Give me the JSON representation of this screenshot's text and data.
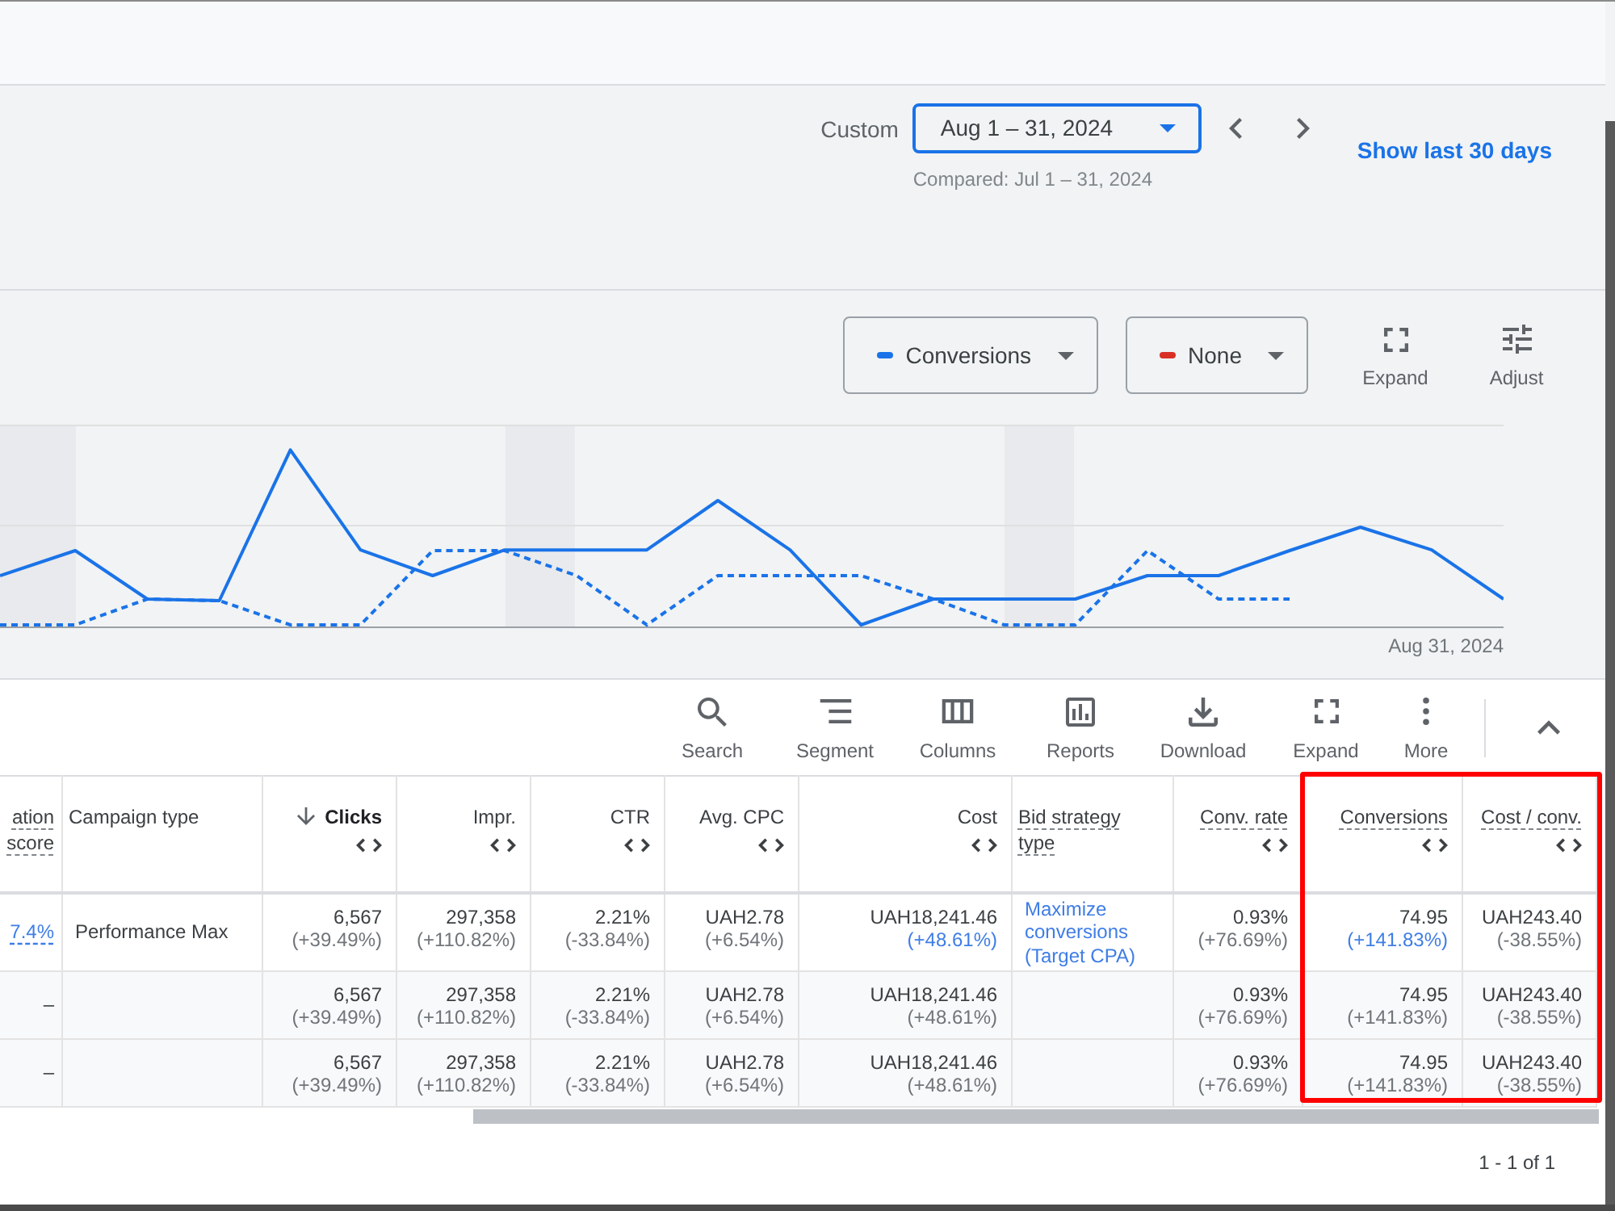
{
  "date_range": {
    "label": "Custom",
    "value": "Aug 1 – 31, 2024",
    "compared": "Compared: Jul 1 – 31, 2024",
    "shortcut": "Show last 30 days"
  },
  "chart": {
    "metrics": [
      {
        "label": "Conversions",
        "color": "#1a73e8"
      },
      {
        "label": "None",
        "color": "#d93025"
      }
    ],
    "actions": [
      {
        "kind": "expand",
        "label": "Expand"
      },
      {
        "kind": "adjust",
        "label": "Adjust"
      }
    ],
    "end_date": "Aug 31, 2024"
  },
  "toolbar": {
    "actions": [
      {
        "kind": "search",
        "label": "Search"
      },
      {
        "kind": "segment",
        "label": "Segment"
      },
      {
        "kind": "columns",
        "label": "Columns"
      },
      {
        "kind": "reports",
        "label": "Reports"
      },
      {
        "kind": "download",
        "label": "Download"
      },
      {
        "kind": "expand",
        "label": "Expand"
      },
      {
        "kind": "more",
        "label": "More"
      }
    ]
  },
  "table": {
    "columns": [
      {
        "label": "ation score",
        "kind": "score",
        "underlined": true,
        "sorted": false,
        "highlighted": false
      },
      {
        "label": "Campaign type",
        "kind": "text",
        "underlined": false,
        "sorted": false,
        "highlighted": false
      },
      {
        "label": "Clicks",
        "kind": "metric",
        "underlined": false,
        "sorted": true,
        "highlighted": false
      },
      {
        "label": "Impr.",
        "kind": "metric",
        "underlined": false,
        "sorted": false,
        "highlighted": false
      },
      {
        "label": "CTR",
        "kind": "metric",
        "underlined": false,
        "sorted": false,
        "highlighted": false
      },
      {
        "label": "Avg. CPC",
        "kind": "metric",
        "underlined": false,
        "sorted": false,
        "highlighted": false
      },
      {
        "label": "Cost",
        "kind": "metric",
        "underlined": false,
        "sorted": false,
        "highlighted": false
      },
      {
        "label": "Bid strategy type",
        "kind": "text",
        "underlined": true,
        "sorted": false,
        "highlighted": false
      },
      {
        "label": "Conv. rate",
        "kind": "metric",
        "underlined": true,
        "sorted": false,
        "highlighted": false
      },
      {
        "label": "Conversions",
        "kind": "metric",
        "underlined": true,
        "sorted": false,
        "highlighted": true
      },
      {
        "label": "Cost / conv.",
        "kind": "metric",
        "underlined": true,
        "sorted": false,
        "highlighted": true
      }
    ],
    "rows": [
      {
        "kind": "campaign",
        "cells": [
          {
            "text": "7.4%",
            "linked": true
          },
          {
            "text": "Performance Max",
            "linked": false
          },
          {
            "value": "6,567",
            "change": "(+39.49%)",
            "linked": false
          },
          {
            "value": "297,358",
            "change": "(+110.82%)",
            "linked": false
          },
          {
            "value": "2.21%",
            "change": "(-33.84%)",
            "linked": false
          },
          {
            "value": "UAH2.78",
            "change": "(+6.54%)",
            "linked": false
          },
          {
            "value": "UAH18,241.46",
            "change": "(+48.61%)",
            "linked": true
          },
          {
            "text": "Maximize conversions (Target CPA)",
            "linked": true
          },
          {
            "value": "0.93%",
            "change": "(+76.69%)",
            "linked": false
          },
          {
            "value": "74.95",
            "change": "(+141.83%)",
            "linked": true
          },
          {
            "value": "UAH243.40",
            "change": "(-38.55%)",
            "linked": false
          }
        ]
      },
      {
        "kind": "total",
        "cells": [
          {
            "text": "–",
            "linked": false
          },
          null,
          {
            "value": "6,567",
            "change": "(+39.49%)",
            "linked": false
          },
          {
            "value": "297,358",
            "change": "(+110.82%)",
            "linked": false
          },
          {
            "value": "2.21%",
            "change": "(-33.84%)",
            "linked": false
          },
          {
            "value": "UAH2.78",
            "change": "(+6.54%)",
            "linked": false
          },
          {
            "value": "UAH18,241.46",
            "change": "(+48.61%)",
            "linked": false
          },
          null,
          {
            "value": "0.93%",
            "change": "(+76.69%)",
            "linked": false
          },
          {
            "value": "74.95",
            "change": "(+141.83%)",
            "linked": false
          },
          {
            "value": "UAH243.40",
            "change": "(-38.55%)",
            "linked": false
          }
        ]
      },
      {
        "kind": "total",
        "cells": [
          {
            "text": "–",
            "linked": false
          },
          null,
          {
            "value": "6,567",
            "change": "(+39.49%)",
            "linked": false
          },
          {
            "value": "297,358",
            "change": "(+110.82%)",
            "linked": false
          },
          {
            "value": "2.21%",
            "change": "(-33.84%)",
            "linked": false
          },
          {
            "value": "UAH2.78",
            "change": "(+6.54%)",
            "linked": false
          },
          {
            "value": "UAH18,241.46",
            "change": "(+48.61%)",
            "linked": false
          },
          null,
          {
            "value": "0.93%",
            "change": "(+76.69%)",
            "linked": false
          },
          {
            "value": "74.95",
            "change": "(+141.83%)",
            "linked": false
          },
          {
            "value": "UAH243.40",
            "change": "(-38.55%)",
            "linked": false
          }
        ]
      }
    ]
  },
  "pagination": "1 - 1 of 1"
}
